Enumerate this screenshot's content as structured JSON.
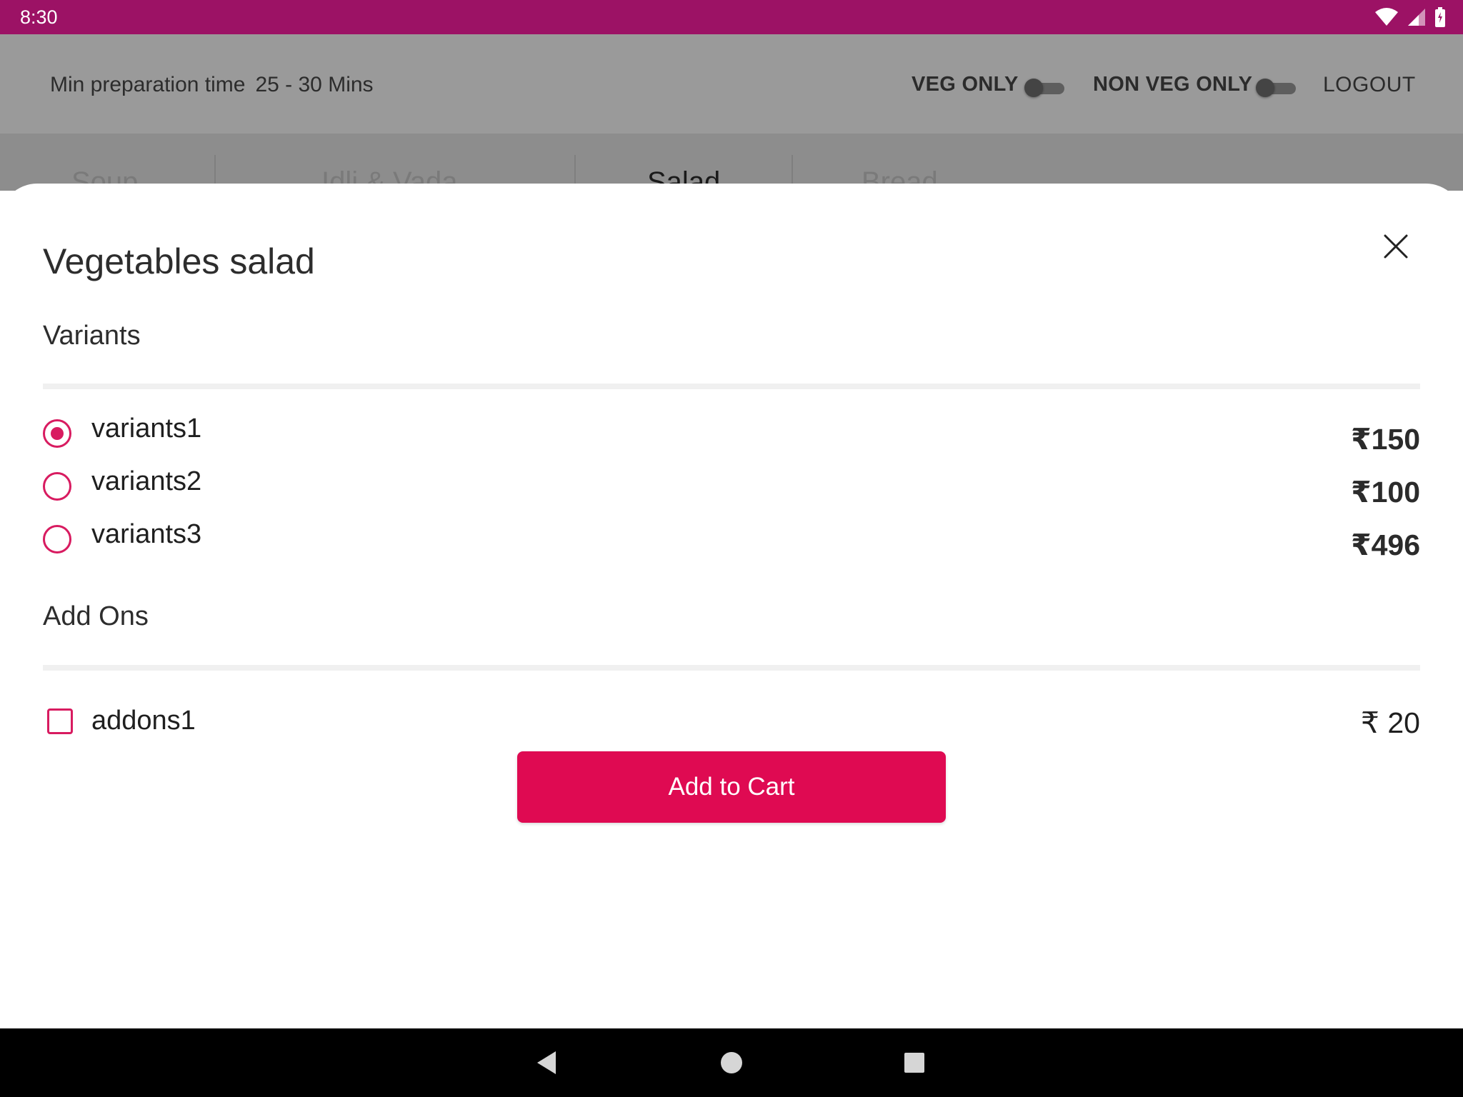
{
  "status_bar": {
    "time": "8:30",
    "icons": [
      "wifi-icon",
      "signal-icon",
      "battery-icon"
    ]
  },
  "header": {
    "prep_time_label": "Min preparation time",
    "prep_time_value": "25 - 30 Mins",
    "veg_only_label": "VEG ONLY",
    "veg_only_enabled": false,
    "non_veg_only_label": "NON VEG ONLY",
    "non_veg_only_enabled": false,
    "logout_label": "LOGOUT"
  },
  "categories": {
    "tabs": [
      {
        "label": "Soup",
        "active": false
      },
      {
        "label": "Idli & Vada",
        "active": false
      },
      {
        "label": "Salad",
        "active": true
      },
      {
        "label": "Bread",
        "active": false
      }
    ]
  },
  "sheet": {
    "title": "Vegetables salad",
    "variants_heading": "Variants",
    "variants": [
      {
        "label": "variants1",
        "price": "₹150",
        "selected": true
      },
      {
        "label": "variants2",
        "price": "₹100",
        "selected": false
      },
      {
        "label": "variants3",
        "price": "₹496",
        "selected": false
      }
    ],
    "addons_heading": "Add Ons",
    "addons": [
      {
        "label": "addons1",
        "price": "₹ 20",
        "checked": false
      }
    ],
    "add_to_cart_label": "Add to Cart",
    "close_icon": "close-icon"
  },
  "nav_bar": {
    "icons": [
      "back-icon",
      "home-icon",
      "recents-icon"
    ]
  },
  "colors": {
    "status_bar": "#9c1265",
    "accent": "#d81b60",
    "button": "#df0a52",
    "scrim": "#9a9a9a"
  }
}
